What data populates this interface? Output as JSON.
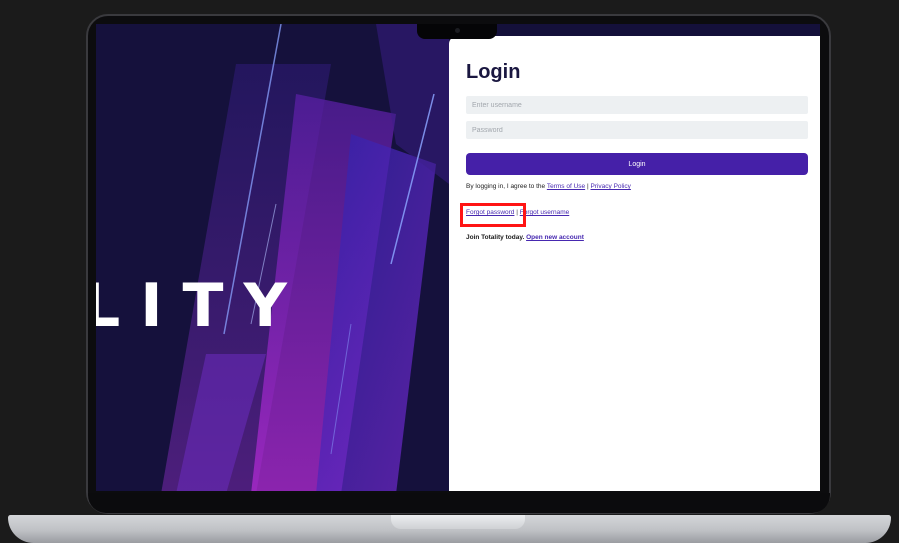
{
  "hero": {
    "wordmark": "LITY"
  },
  "login": {
    "title": "Login",
    "username_placeholder": "Enter username",
    "password_placeholder": "Password",
    "button_label": "Login",
    "terms_prefix": "By logging in, I agree to the",
    "terms_link": "Terms of Use",
    "terms_separator": "|",
    "privacy_link": "Privacy Policy",
    "forgot_password": "Forgot password",
    "forgot_separator": "|",
    "forgot_username": "Forgot username",
    "join_text": "Join Totality today.",
    "join_link": "Open new account"
  },
  "colors": {
    "accent": "#4520a8",
    "highlight": "#ff1414"
  }
}
